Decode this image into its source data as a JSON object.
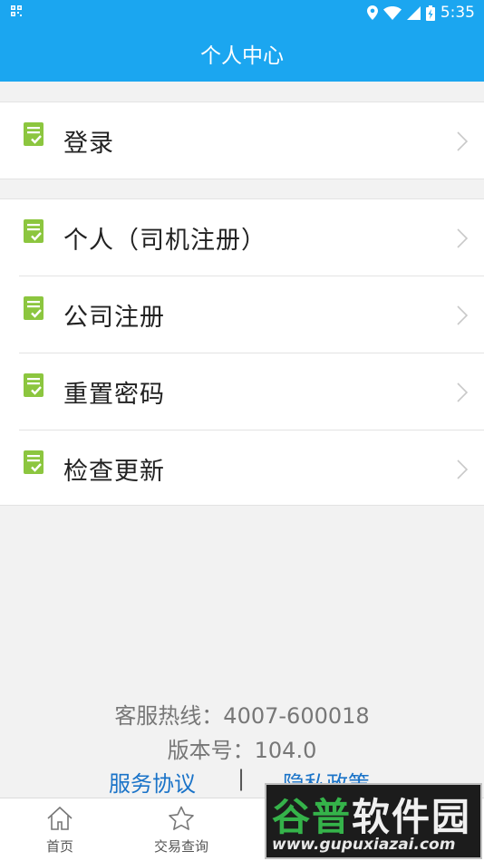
{
  "status_bar": {
    "left_icon": "qr-icon",
    "time": "5:35",
    "icons": [
      "location-icon",
      "wifi-icon",
      "signal-icon",
      "battery-charging-icon"
    ]
  },
  "header": {
    "title": "个人中心"
  },
  "menu": {
    "login": {
      "label": "登录",
      "icon": "document-check-icon"
    },
    "items": [
      {
        "label": "个人（司机注册）",
        "icon": "document-check-icon"
      },
      {
        "label": "公司注册",
        "icon": "document-check-icon"
      },
      {
        "label": "重置密码",
        "icon": "document-check-icon"
      },
      {
        "label": "检查更新",
        "icon": "document-check-icon"
      }
    ]
  },
  "footer": {
    "hotline": "客服热线：4007-600018",
    "version": "版本号：104.0",
    "service_agreement": "服务协议",
    "separator": "|",
    "privacy_policy": "隐私政策"
  },
  "tabbar": {
    "tabs": [
      {
        "label": "首页",
        "icon": "home-icon"
      },
      {
        "label": "交易查询",
        "icon": "star-icon"
      }
    ]
  },
  "watermark": {
    "brand_part1": "谷普",
    "brand_part2": "软件园",
    "url": "www.gupuxiazai.com"
  },
  "colors": {
    "primary": "#1ba6f0",
    "link": "#1a73c8",
    "icon_green": "#8cc63f",
    "background": "#f2f2f2"
  }
}
